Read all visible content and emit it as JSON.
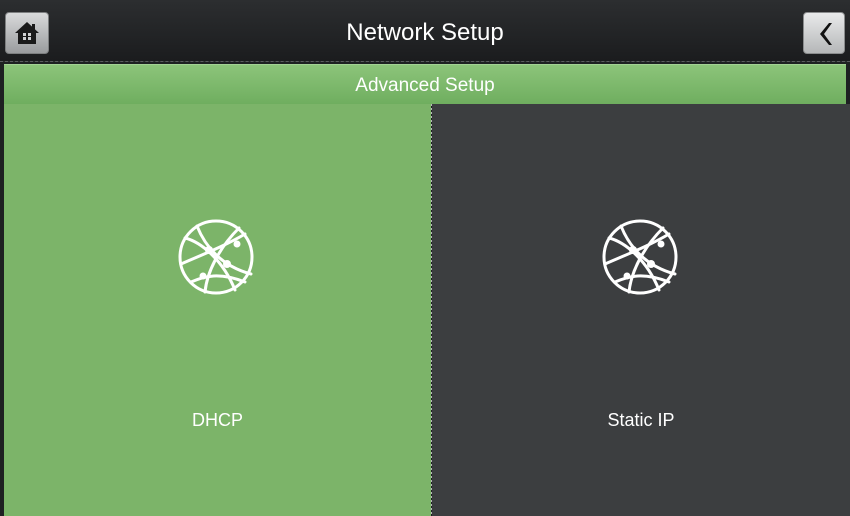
{
  "header": {
    "title": "Network Setup",
    "home_icon": "home-icon",
    "back_icon": "chevron-left-icon"
  },
  "subheader": {
    "title": "Advanced Setup"
  },
  "options": [
    {
      "label": "DHCP",
      "icon": "globe-network-icon",
      "selected": true,
      "color": "#7cb469"
    },
    {
      "label": "Static IP",
      "icon": "globe-network-icon",
      "selected": false,
      "color": "#3c3e40"
    }
  ],
  "colors": {
    "accent": "#7cb469",
    "header_bg": "#1b1c1e",
    "panel_dark": "#3c3e40"
  }
}
